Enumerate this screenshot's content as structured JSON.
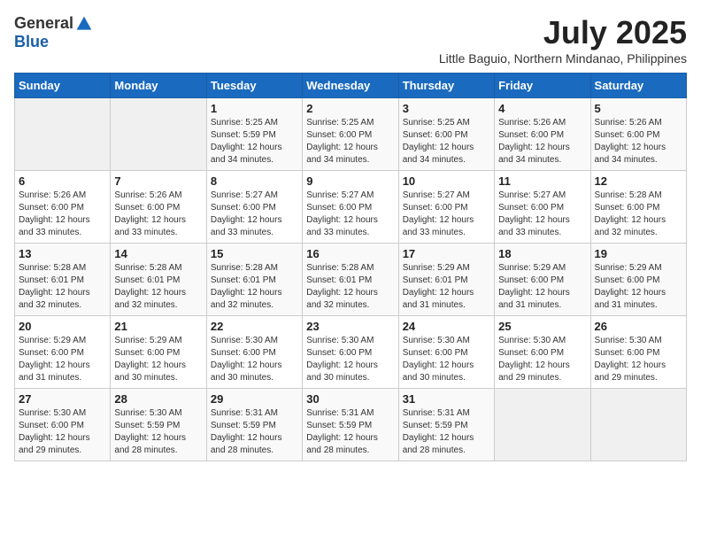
{
  "header": {
    "logo_general": "General",
    "logo_blue": "Blue",
    "month_year": "July 2025",
    "location": "Little Baguio, Northern Mindanao, Philippines"
  },
  "weekdays": [
    "Sunday",
    "Monday",
    "Tuesday",
    "Wednesday",
    "Thursday",
    "Friday",
    "Saturday"
  ],
  "weeks": [
    [
      {
        "day": "",
        "info": ""
      },
      {
        "day": "",
        "info": ""
      },
      {
        "day": "1",
        "info": "Sunrise: 5:25 AM\nSunset: 5:59 PM\nDaylight: 12 hours and 34 minutes."
      },
      {
        "day": "2",
        "info": "Sunrise: 5:25 AM\nSunset: 6:00 PM\nDaylight: 12 hours and 34 minutes."
      },
      {
        "day": "3",
        "info": "Sunrise: 5:25 AM\nSunset: 6:00 PM\nDaylight: 12 hours and 34 minutes."
      },
      {
        "day": "4",
        "info": "Sunrise: 5:26 AM\nSunset: 6:00 PM\nDaylight: 12 hours and 34 minutes."
      },
      {
        "day": "5",
        "info": "Sunrise: 5:26 AM\nSunset: 6:00 PM\nDaylight: 12 hours and 34 minutes."
      }
    ],
    [
      {
        "day": "6",
        "info": "Sunrise: 5:26 AM\nSunset: 6:00 PM\nDaylight: 12 hours and 33 minutes."
      },
      {
        "day": "7",
        "info": "Sunrise: 5:26 AM\nSunset: 6:00 PM\nDaylight: 12 hours and 33 minutes."
      },
      {
        "day": "8",
        "info": "Sunrise: 5:27 AM\nSunset: 6:00 PM\nDaylight: 12 hours and 33 minutes."
      },
      {
        "day": "9",
        "info": "Sunrise: 5:27 AM\nSunset: 6:00 PM\nDaylight: 12 hours and 33 minutes."
      },
      {
        "day": "10",
        "info": "Sunrise: 5:27 AM\nSunset: 6:00 PM\nDaylight: 12 hours and 33 minutes."
      },
      {
        "day": "11",
        "info": "Sunrise: 5:27 AM\nSunset: 6:00 PM\nDaylight: 12 hours and 33 minutes."
      },
      {
        "day": "12",
        "info": "Sunrise: 5:28 AM\nSunset: 6:00 PM\nDaylight: 12 hours and 32 minutes."
      }
    ],
    [
      {
        "day": "13",
        "info": "Sunrise: 5:28 AM\nSunset: 6:01 PM\nDaylight: 12 hours and 32 minutes."
      },
      {
        "day": "14",
        "info": "Sunrise: 5:28 AM\nSunset: 6:01 PM\nDaylight: 12 hours and 32 minutes."
      },
      {
        "day": "15",
        "info": "Sunrise: 5:28 AM\nSunset: 6:01 PM\nDaylight: 12 hours and 32 minutes."
      },
      {
        "day": "16",
        "info": "Sunrise: 5:28 AM\nSunset: 6:01 PM\nDaylight: 12 hours and 32 minutes."
      },
      {
        "day": "17",
        "info": "Sunrise: 5:29 AM\nSunset: 6:01 PM\nDaylight: 12 hours and 31 minutes."
      },
      {
        "day": "18",
        "info": "Sunrise: 5:29 AM\nSunset: 6:00 PM\nDaylight: 12 hours and 31 minutes."
      },
      {
        "day": "19",
        "info": "Sunrise: 5:29 AM\nSunset: 6:00 PM\nDaylight: 12 hours and 31 minutes."
      }
    ],
    [
      {
        "day": "20",
        "info": "Sunrise: 5:29 AM\nSunset: 6:00 PM\nDaylight: 12 hours and 31 minutes."
      },
      {
        "day": "21",
        "info": "Sunrise: 5:29 AM\nSunset: 6:00 PM\nDaylight: 12 hours and 30 minutes."
      },
      {
        "day": "22",
        "info": "Sunrise: 5:30 AM\nSunset: 6:00 PM\nDaylight: 12 hours and 30 minutes."
      },
      {
        "day": "23",
        "info": "Sunrise: 5:30 AM\nSunset: 6:00 PM\nDaylight: 12 hours and 30 minutes."
      },
      {
        "day": "24",
        "info": "Sunrise: 5:30 AM\nSunset: 6:00 PM\nDaylight: 12 hours and 30 minutes."
      },
      {
        "day": "25",
        "info": "Sunrise: 5:30 AM\nSunset: 6:00 PM\nDaylight: 12 hours and 29 minutes."
      },
      {
        "day": "26",
        "info": "Sunrise: 5:30 AM\nSunset: 6:00 PM\nDaylight: 12 hours and 29 minutes."
      }
    ],
    [
      {
        "day": "27",
        "info": "Sunrise: 5:30 AM\nSunset: 6:00 PM\nDaylight: 12 hours and 29 minutes."
      },
      {
        "day": "28",
        "info": "Sunrise: 5:30 AM\nSunset: 5:59 PM\nDaylight: 12 hours and 28 minutes."
      },
      {
        "day": "29",
        "info": "Sunrise: 5:31 AM\nSunset: 5:59 PM\nDaylight: 12 hours and 28 minutes."
      },
      {
        "day": "30",
        "info": "Sunrise: 5:31 AM\nSunset: 5:59 PM\nDaylight: 12 hours and 28 minutes."
      },
      {
        "day": "31",
        "info": "Sunrise: 5:31 AM\nSunset: 5:59 PM\nDaylight: 12 hours and 28 minutes."
      },
      {
        "day": "",
        "info": ""
      },
      {
        "day": "",
        "info": ""
      }
    ]
  ]
}
